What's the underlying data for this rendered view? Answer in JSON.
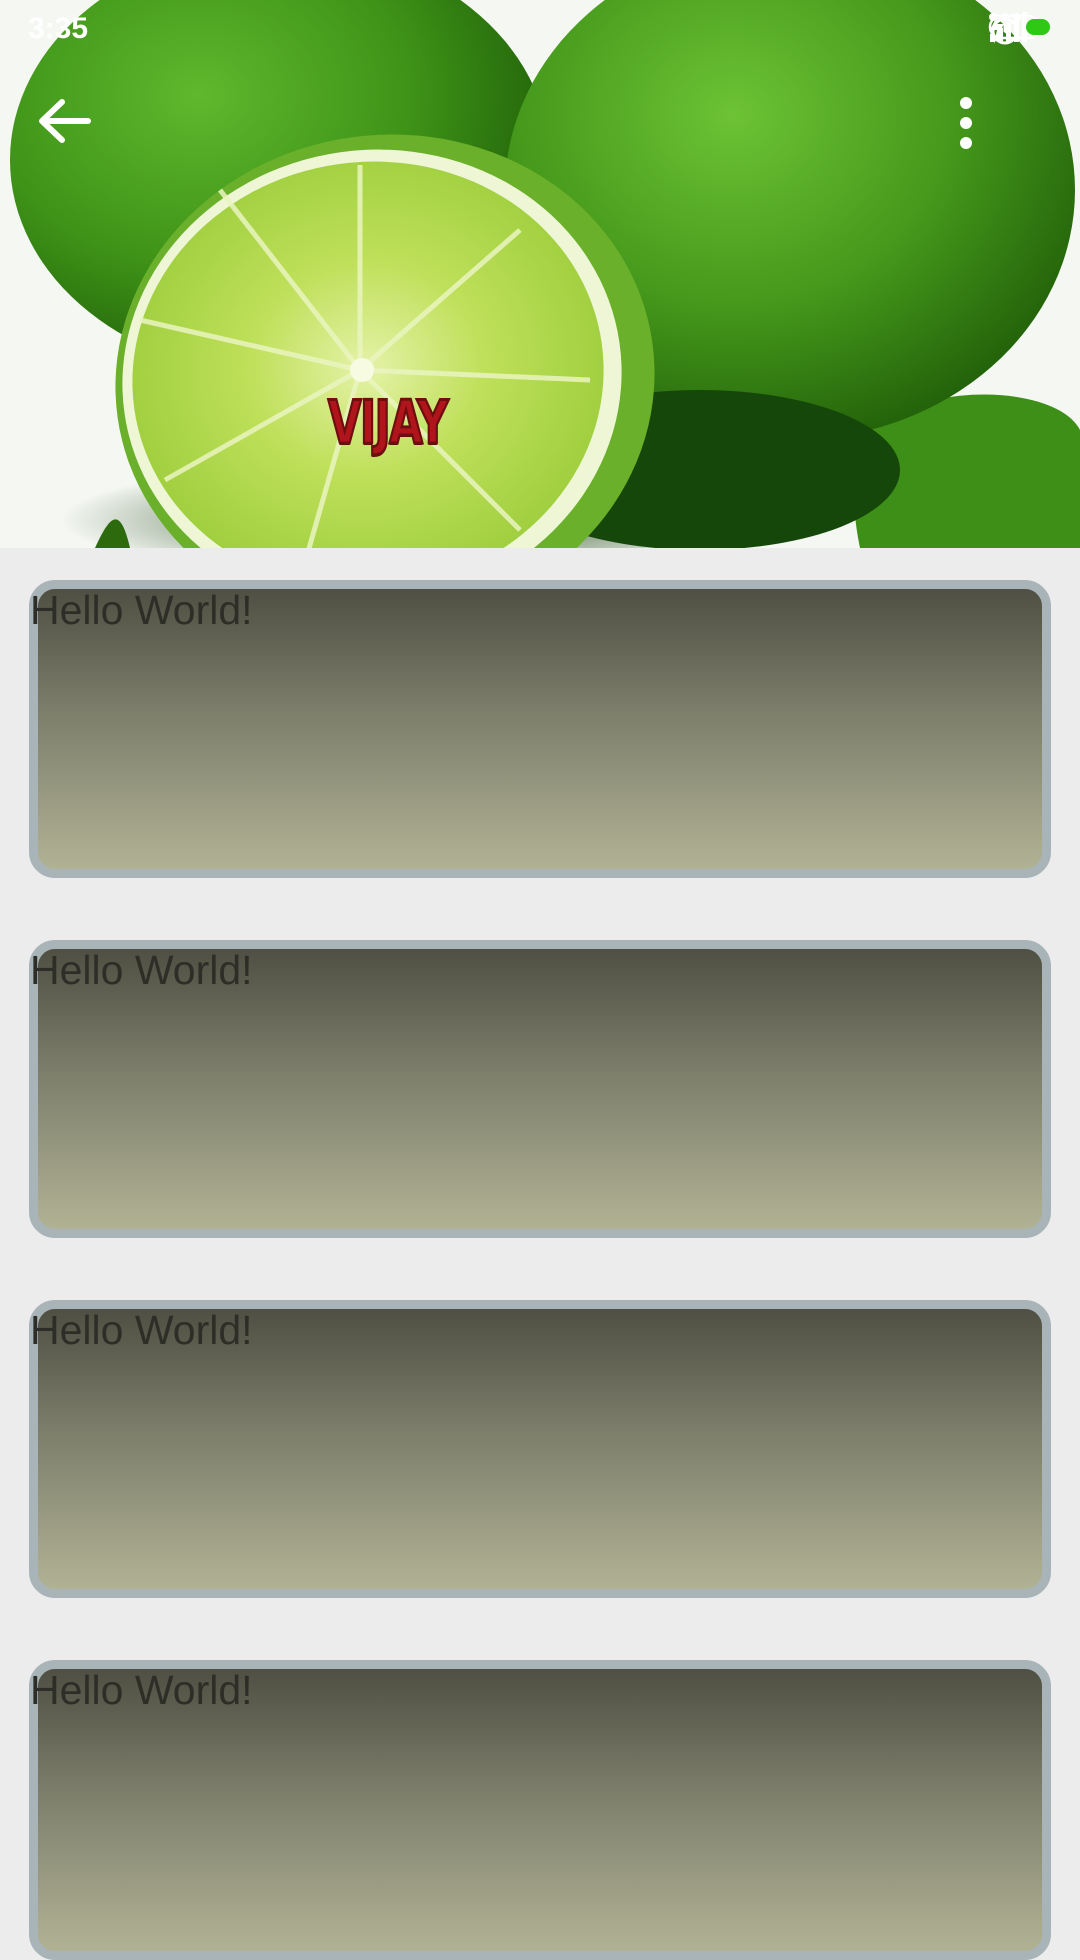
{
  "status_bar": {
    "time": "3:35",
    "icons": [
      "more-dots-icon",
      "alarm-icon",
      "signal-icon",
      "charging-icon",
      "battery-icon"
    ],
    "battery_color": "#2fc915"
  },
  "toolbar": {
    "back_icon": "arrow-left-icon",
    "menu_icon": "more-vertical-icon"
  },
  "header_image": {
    "subject": "limes",
    "watermark_text": "VIJAY",
    "watermark_color": "#b0151c"
  },
  "cards": [
    {
      "label": "Hello World!"
    },
    {
      "label": "Hello World!"
    },
    {
      "label": "Hello World!"
    },
    {
      "label": "Hello World!"
    }
  ],
  "colors": {
    "background": "#ececec",
    "card_border": "#a8b4b8",
    "card_gradient_top": "#4f4f43",
    "card_gradient_bottom": "#b1b294",
    "card_text": "#2e2e28"
  }
}
